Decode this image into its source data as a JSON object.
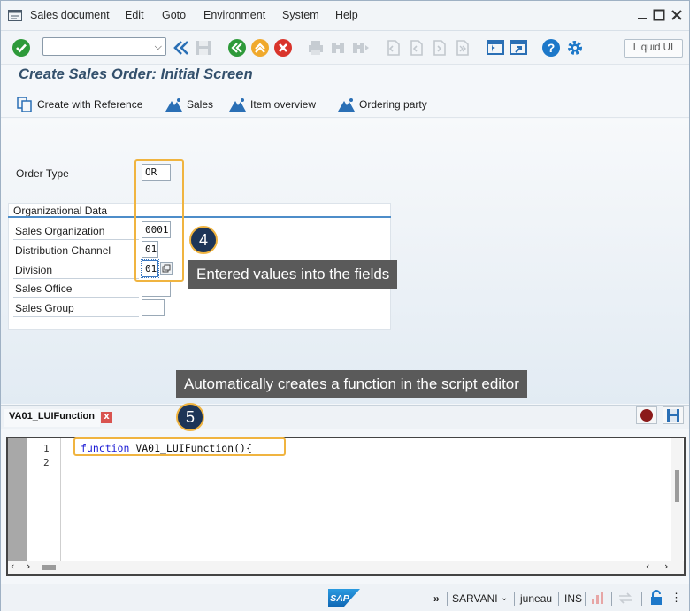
{
  "menu": {
    "items": [
      "Sales document",
      "Edit",
      "Goto",
      "Environment",
      "System",
      "Help"
    ]
  },
  "toolbar": {
    "command_field_value": "",
    "liquid_ui_label": "Liquid UI",
    "icons": [
      "enter-check-icon",
      "back-double-icon",
      "save-icon",
      "back-icon",
      "exit-icon",
      "cancel-icon",
      "print-icon",
      "find-icon",
      "find-next-icon",
      "first-page-icon",
      "prev-page-icon",
      "next-page-icon",
      "last-page-icon",
      "new-session-icon",
      "shortcut-icon",
      "help-icon",
      "settings-icon"
    ]
  },
  "title": "Create Sales Order: Initial Screen",
  "app_toolbar": {
    "create_with_reference": "Create with Reference",
    "sales": "Sales",
    "item_overview": "Item overview",
    "ordering_party": "Ordering party"
  },
  "form": {
    "order_type_label": "Order Type",
    "order_type_value": "OR",
    "org_group_title": "Organizational Data",
    "sales_org_label": "Sales Organization",
    "sales_org_value": "0001",
    "dist_channel_label": "Distribution Channel",
    "dist_channel_value": "01",
    "division_label": "Division",
    "division_value": "01",
    "sales_office_label": "Sales Office",
    "sales_office_value": "",
    "sales_group_label": "Sales Group",
    "sales_group_value": ""
  },
  "annotations": {
    "step4_number": "4",
    "step4_text": "Entered values into the fields",
    "step5_number": "5",
    "step5_text": "Automatically creates a function in the script editor"
  },
  "editor": {
    "tab_label": "VA01_LUIFunction",
    "close_label": "x",
    "line_numbers": [
      "1",
      "2"
    ],
    "code_keyword": "function",
    "code_rest": " VA01_LUIFunction(){"
  },
  "status": {
    "user": "SARVANI",
    "client": "juneau",
    "mode": "INS",
    "logo_text": "SAP"
  },
  "colors": {
    "highlight": "#f0b440",
    "badge_bg": "#1d3557",
    "callout_bg": "#5a5a5a",
    "title": "#33506c",
    "group_line": "#4d8dc9"
  }
}
